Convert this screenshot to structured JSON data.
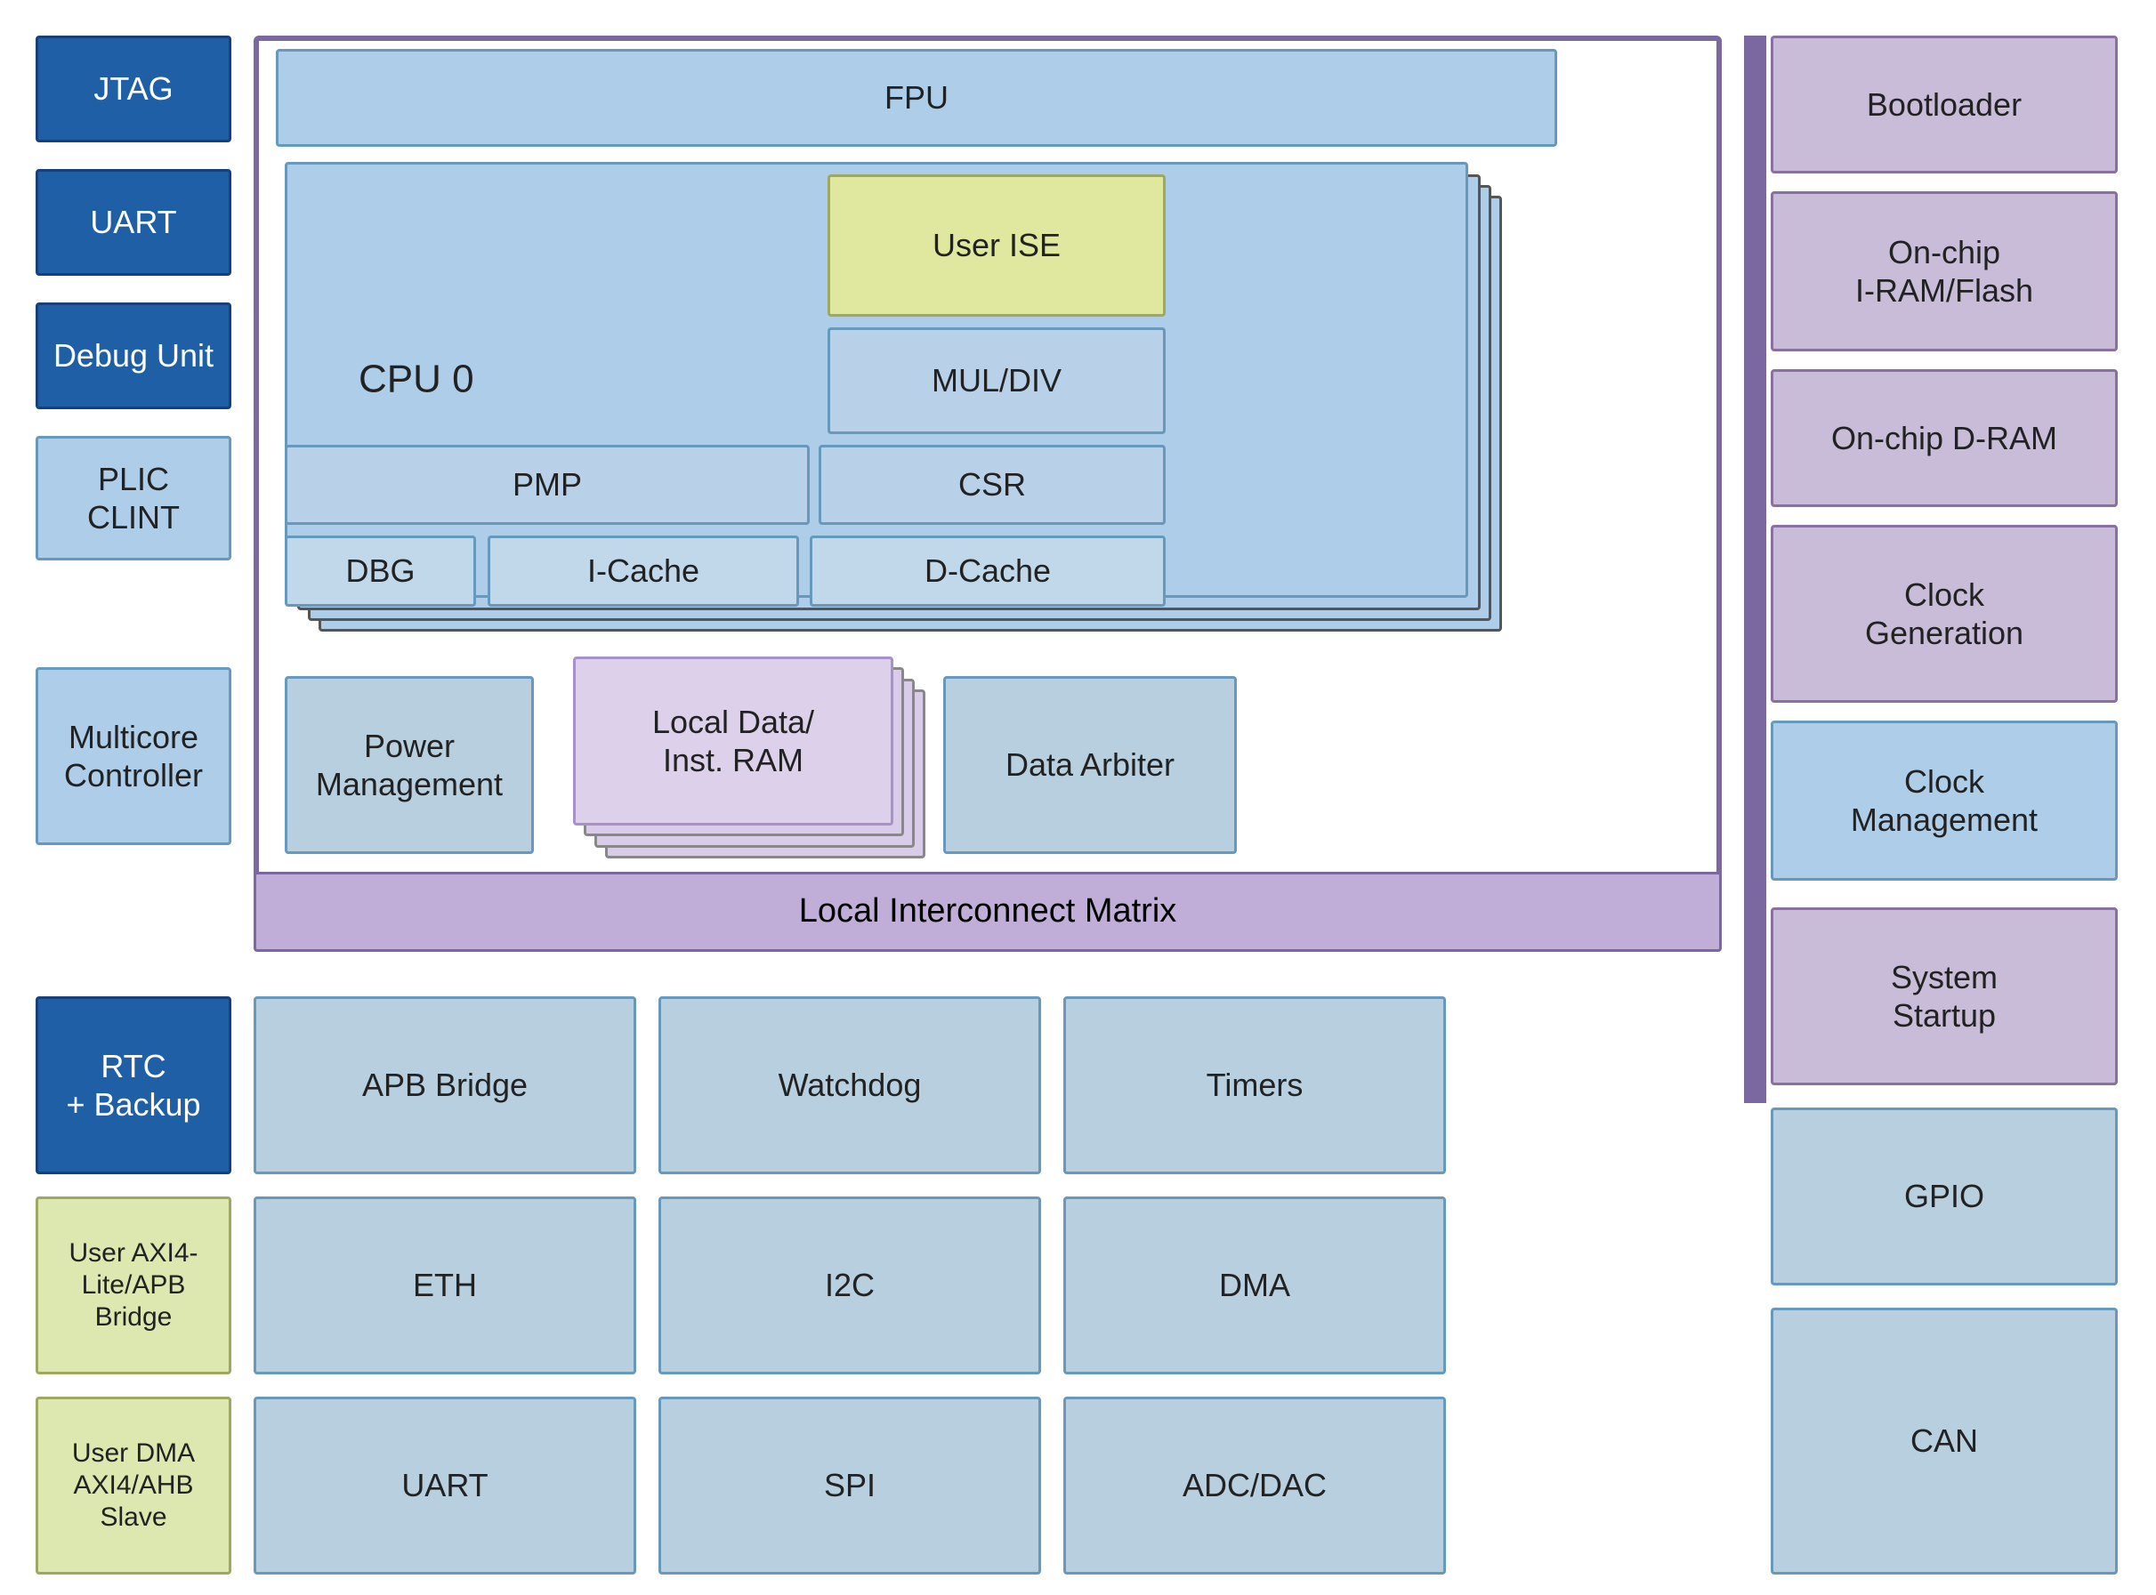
{
  "blocks": {
    "jtag": {
      "label": "JTAG"
    },
    "uart_left": {
      "label": "UART"
    },
    "debug_unit": {
      "label": "Debug Unit"
    },
    "plic_clint": {
      "label": "PLIC\nCLINT"
    },
    "multicore": {
      "label": "Multicore\nController"
    },
    "fpu": {
      "label": "FPU"
    },
    "cpu0": {
      "label": "CPU 0"
    },
    "user_ise": {
      "label": "User ISE"
    },
    "mul_div": {
      "label": "MUL/DIV"
    },
    "pmp": {
      "label": "PMP"
    },
    "csr": {
      "label": "CSR"
    },
    "dbg": {
      "label": "DBG"
    },
    "icache": {
      "label": "I-Cache"
    },
    "dcache": {
      "label": "D-Cache"
    },
    "power_mgmt": {
      "label": "Power\nManagement"
    },
    "local_data_ram": {
      "label": "Local Data/\nInst. RAM"
    },
    "data_arbiter": {
      "label": "Data Arbiter"
    },
    "local_interconnect": {
      "label": "Local Interconnect Matrix"
    },
    "rtc_backup": {
      "label": "RTC\n+ Backup"
    },
    "apb_bridge": {
      "label": "APB Bridge"
    },
    "watchdog": {
      "label": "Watchdog"
    },
    "timers": {
      "label": "Timers"
    },
    "user_axi_apb": {
      "label": "User AXI4-Lite/APB\nBridge"
    },
    "eth": {
      "label": "ETH"
    },
    "i2c": {
      "label": "I2C"
    },
    "dma": {
      "label": "DMA"
    },
    "gpio": {
      "label": "GPIO"
    },
    "user_dma": {
      "label": "User DMA\nAXI4/AHB Slave"
    },
    "uart_bottom": {
      "label": "UART"
    },
    "spi": {
      "label": "SPI"
    },
    "adc_dac": {
      "label": "ADC/DAC"
    },
    "can": {
      "label": "CAN"
    },
    "bootloader": {
      "label": "Bootloader"
    },
    "onchip_iram": {
      "label": "On-chip\nI-RAM/Flash"
    },
    "onchip_dram": {
      "label": "On-chip D-RAM"
    },
    "clock_gen": {
      "label": "Clock\nGeneration"
    },
    "clock_mgmt": {
      "label": "Clock\nManagement"
    },
    "system_startup": {
      "label": "System\nStartup"
    }
  }
}
